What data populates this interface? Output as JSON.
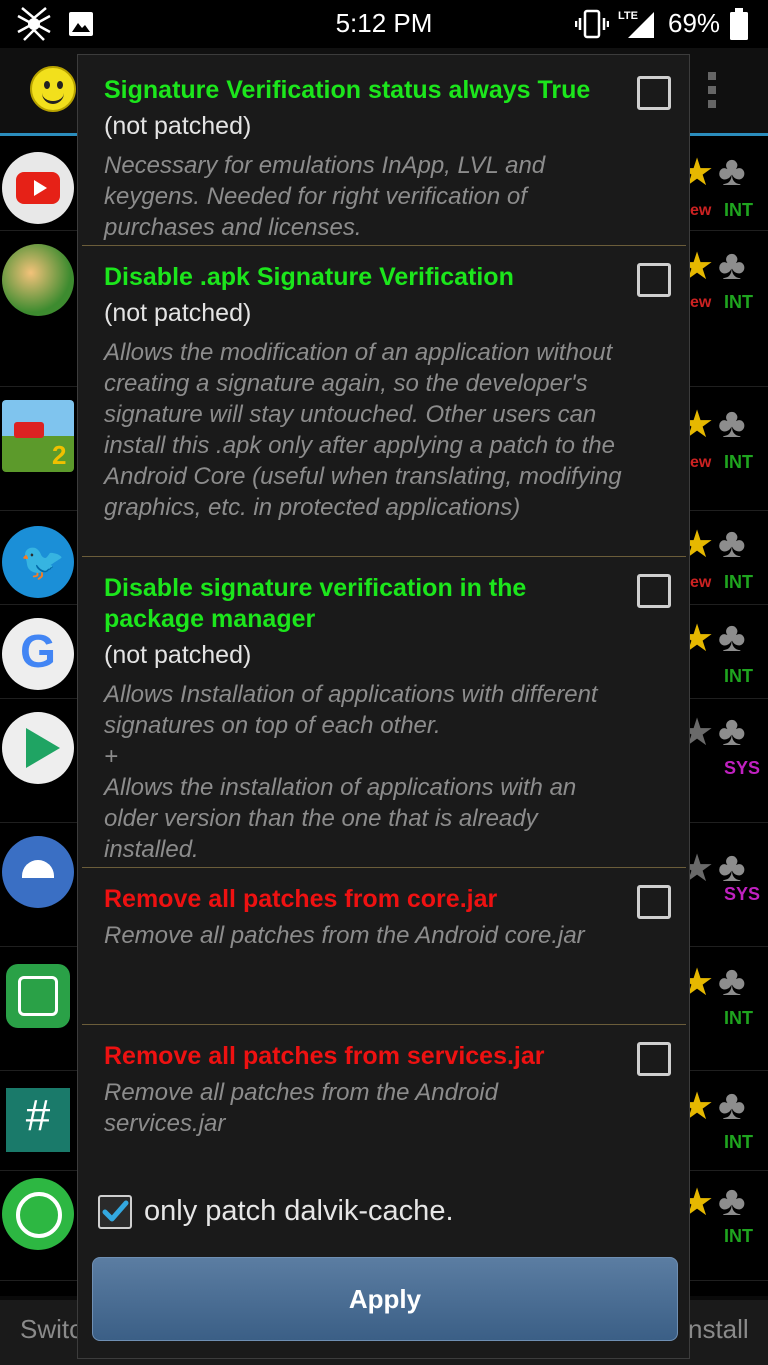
{
  "status_bar": {
    "time": "5:12 PM",
    "battery_percent": "69%",
    "network": "LTE",
    "icons": [
      "spider-icon",
      "image-icon",
      "vibrate-icon",
      "lte-signal-icon",
      "battery-icon"
    ]
  },
  "background": {
    "tags": [
      "INT",
      "INT",
      "INT",
      "INT",
      "INT",
      "SYS",
      "SYS",
      "INT",
      "INT",
      "INT"
    ],
    "new_badge": "ew",
    "bottom_left": "Switc",
    "bottom_right": "nstall"
  },
  "dialog": {
    "options": [
      {
        "title": "Signature Verification status always True",
        "status": "(not patched)",
        "description": "Necessary for emulations InApp, LVL and keygens. Needed for right verification of purchases and licenses.",
        "checked": false
      },
      {
        "title": "Disable .apk Signature Verification",
        "status": "(not patched)",
        "description": "Allows the modification of an application without creating a signature again, so the developer's signature will stay untouched. Other users can install this .apk only after applying a patch to the Android Core (useful when translating, modifying graphics, etc. in protected applications)",
        "checked": false
      },
      {
        "title": "Disable signature verification in the package manager",
        "status": "(not patched)",
        "description_line1": "Allows Installation of applications with different signatures on top of each other.",
        "description_plus": "+",
        "description_line2": "Allows the installation of applications with an older version than the one that is already installed.",
        "checked": false
      },
      {
        "title": "Remove all patches from core.jar",
        "description": "Remove all patches from the Android core.jar",
        "checked": false
      },
      {
        "title": "Remove all patches from services.jar",
        "description": "Remove all patches from the Android services.jar",
        "checked": false
      }
    ],
    "dalvik_label": "only patch dalvik-cache.",
    "dalvik_checked": true,
    "apply_label": "Apply"
  },
  "colors": {
    "accent_green": "#1ce61c",
    "accent_red": "#ee1111",
    "apply_button": "#4a6e95",
    "checkbox_check": "#33a8e0"
  }
}
